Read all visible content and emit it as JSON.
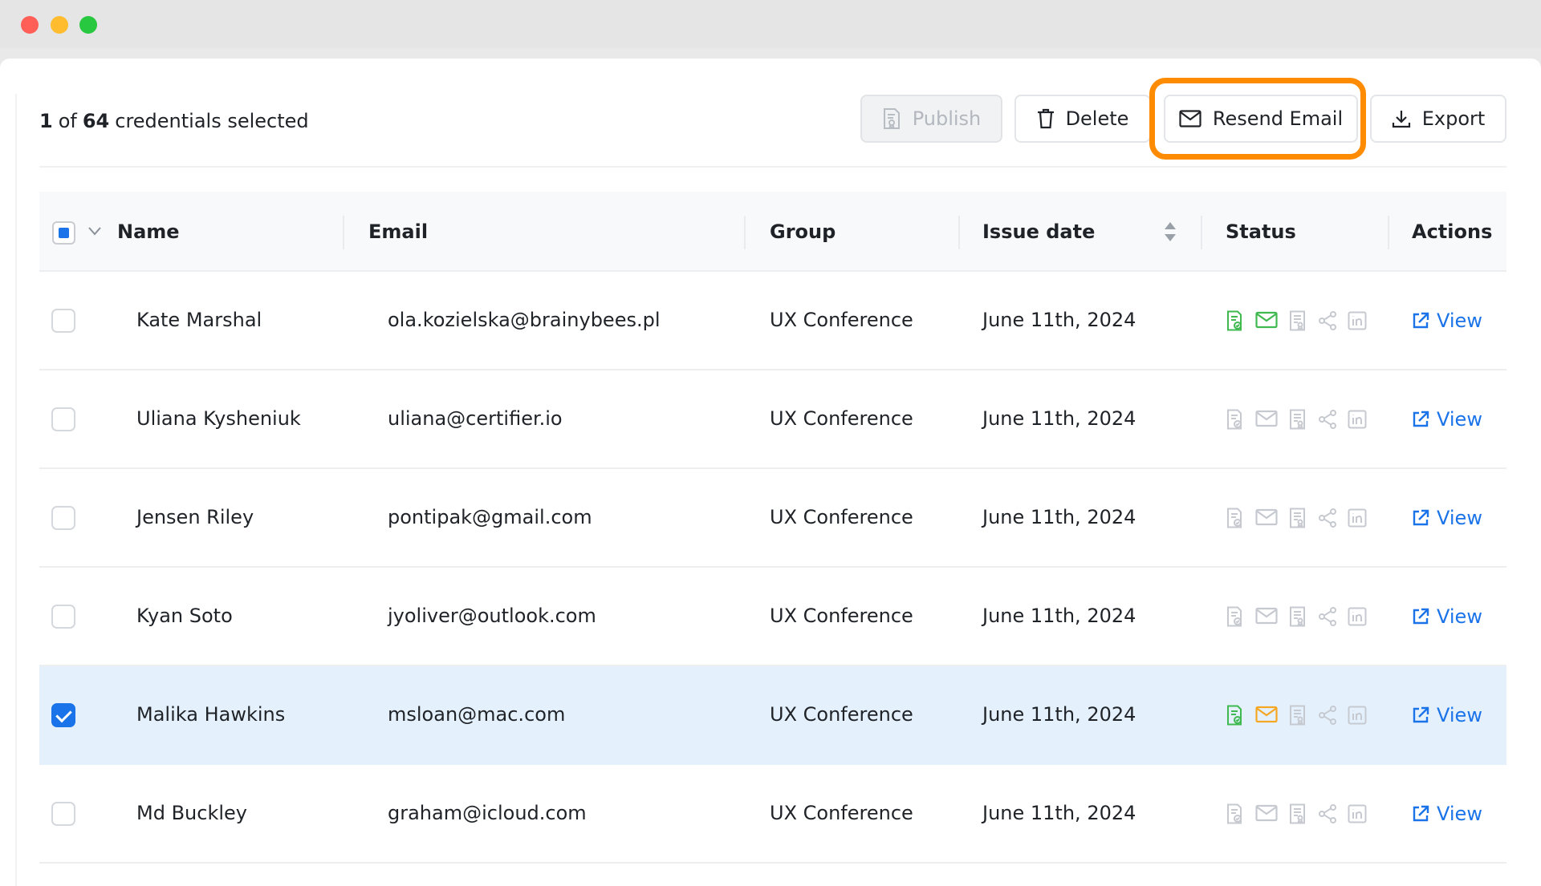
{
  "toolbar": {
    "selected_count": "1",
    "of_label": "of",
    "total_count": "64",
    "suffix": "credentials selected",
    "publish_label": "Publish",
    "delete_label": "Delete",
    "resend_label": "Resend Email",
    "export_label": "Export"
  },
  "table": {
    "columns": [
      "Name",
      "Email",
      "Group",
      "Issue date",
      "Status",
      "Actions"
    ],
    "view_label": "View",
    "rows": [
      {
        "name": "Kate Marshal",
        "email": "ola.kozielska@brainybees.pl",
        "group": "UX Conference",
        "date": "June 11th, 2024",
        "checked": false,
        "status": [
          "published",
          "emailed",
          "none",
          "none",
          "none"
        ]
      },
      {
        "name": "Uliana Kysheniuk",
        "email": "uliana@certifier.io",
        "group": "UX Conference",
        "date": "June 11th, 2024",
        "checked": false,
        "status": [
          "none",
          "none",
          "none",
          "none",
          "none"
        ]
      },
      {
        "name": "Jensen Riley",
        "email": "pontipak@gmail.com",
        "group": "UX Conference",
        "date": "June 11th, 2024",
        "checked": false,
        "status": [
          "none",
          "none",
          "none",
          "none",
          "none"
        ]
      },
      {
        "name": "Kyan Soto",
        "email": "jyoliver@outlook.com",
        "group": "UX Conference",
        "date": "June 11th, 2024",
        "checked": false,
        "status": [
          "none",
          "none",
          "none",
          "none",
          "none"
        ]
      },
      {
        "name": "Malika Hawkins",
        "email": "msloan@mac.com",
        "group": "UX Conference",
        "date": "June 11th, 2024",
        "checked": true,
        "status": [
          "published",
          "pending",
          "none",
          "none",
          "none"
        ]
      },
      {
        "name": "Md Buckley",
        "email": "graham@icloud.com",
        "group": "UX Conference",
        "date": "June 11th, 2024",
        "checked": false,
        "status": [
          "none",
          "none",
          "none",
          "none",
          "none"
        ]
      }
    ]
  },
  "status_icons": [
    "certificate-published-icon",
    "email-icon",
    "credential-viewed-icon",
    "share-icon",
    "linkedin-icon"
  ],
  "colors": {
    "accent": "#1a73e8",
    "published": "#3fb950",
    "emailed": "#3fb950",
    "pending": "#f5a623",
    "inactive": "#c6cad0",
    "highlight": "#ff8c00",
    "selected_row": "#e4f1fd"
  }
}
